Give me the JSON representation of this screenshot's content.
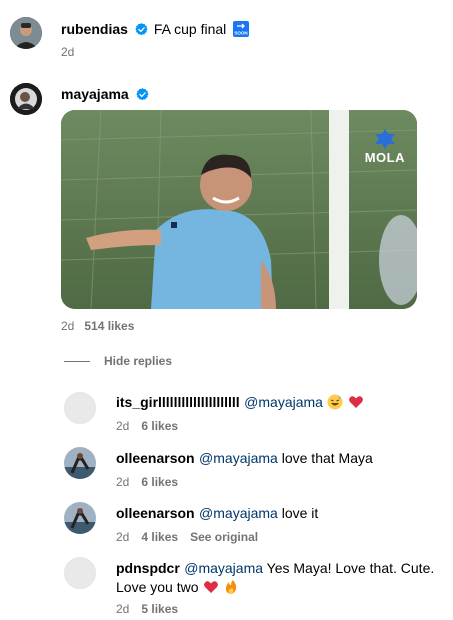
{
  "post": {
    "username": "rubendias",
    "caption": "FA cup final",
    "caption_emoji": "soon-arrow-icon",
    "time": "2d"
  },
  "comment_main": {
    "username": "mayajama",
    "time": "2d",
    "likes": "514 likes",
    "gif_watermark": "MOLA"
  },
  "hide_replies": "Hide replies",
  "replies": [
    {
      "username": "its_girlllllllllllllllllllll",
      "mention": "@mayajama",
      "text": "",
      "time": "2d",
      "likes": "6 likes",
      "emojis": [
        "grinning-sweat-emoji",
        "red-heart-emoji"
      ]
    },
    {
      "username": "olleenarson",
      "mention": "@mayajama",
      "text": " love that Maya",
      "time": "2d",
      "likes": "6 likes"
    },
    {
      "username": "olleenarson",
      "mention": "@mayajama",
      "text": " love it",
      "time": "2d",
      "likes": "4 likes",
      "see_original": "See original"
    },
    {
      "username": "pdnspdcr",
      "mention": "@mayajama",
      "text": " Yes Maya! Love that. Cute.",
      "text_line2": "Love you two",
      "time": "2d",
      "likes": "5 likes",
      "emojis": [
        "red-heart-emoji",
        "fire-emoji"
      ]
    }
  ],
  "colors": {
    "verified": "#0095f6",
    "mention": "#00376b",
    "meta": "#737373"
  }
}
